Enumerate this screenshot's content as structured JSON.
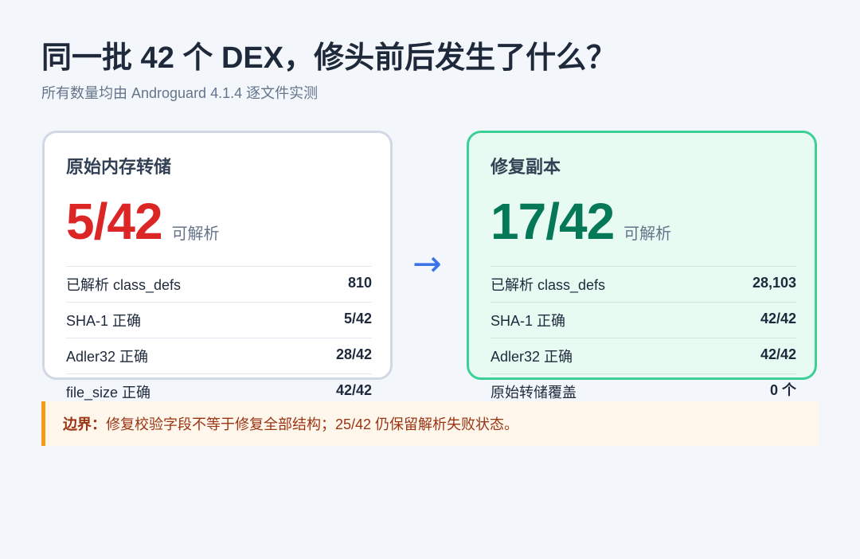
{
  "header": {
    "title": "同一批 42 个 DEX，修头前后发生了什么？",
    "subtitle": "所有数量均由 Androguard 4.1.4 逐文件实测"
  },
  "colors": {
    "background": "#f3f7fc",
    "left_big_number": "#dc2626",
    "right_big_number": "#047857",
    "left_card_border": "#cfd8e4",
    "right_card_border": "#3ccf96",
    "right_card_background": "#e7fbf3",
    "arrow": "#3b74e6",
    "note_accent": "#f39c12",
    "note_text": "#9a3412"
  },
  "cards": [
    {
      "title": "原始内存转储",
      "big_number": "5/42",
      "big_unit": "可解析",
      "metrics": [
        {
          "label": "已解析 class_defs",
          "value": "810"
        },
        {
          "label": "SHA-1 正确",
          "value": "5/42"
        },
        {
          "label": "Adler32 正确",
          "value": "28/42"
        },
        {
          "label": "file_size 正确",
          "value": "42/42"
        }
      ]
    },
    {
      "title": "修复副本",
      "big_number": "17/42",
      "big_unit": "可解析",
      "metrics": [
        {
          "label": "已解析 class_defs",
          "value": "28,103"
        },
        {
          "label": "SHA-1 正确",
          "value": "42/42"
        },
        {
          "label": "Adler32 正确",
          "value": "42/42"
        },
        {
          "label": "原始转储覆盖",
          "value": "0 个"
        }
      ]
    }
  ],
  "arrow_icon": "arrow-right-icon",
  "arrow_glyph": "→",
  "note": {
    "label": "边界：",
    "text": "修复校验字段不等于修复全部结构；25/42 仍保留解析失败状态。"
  }
}
